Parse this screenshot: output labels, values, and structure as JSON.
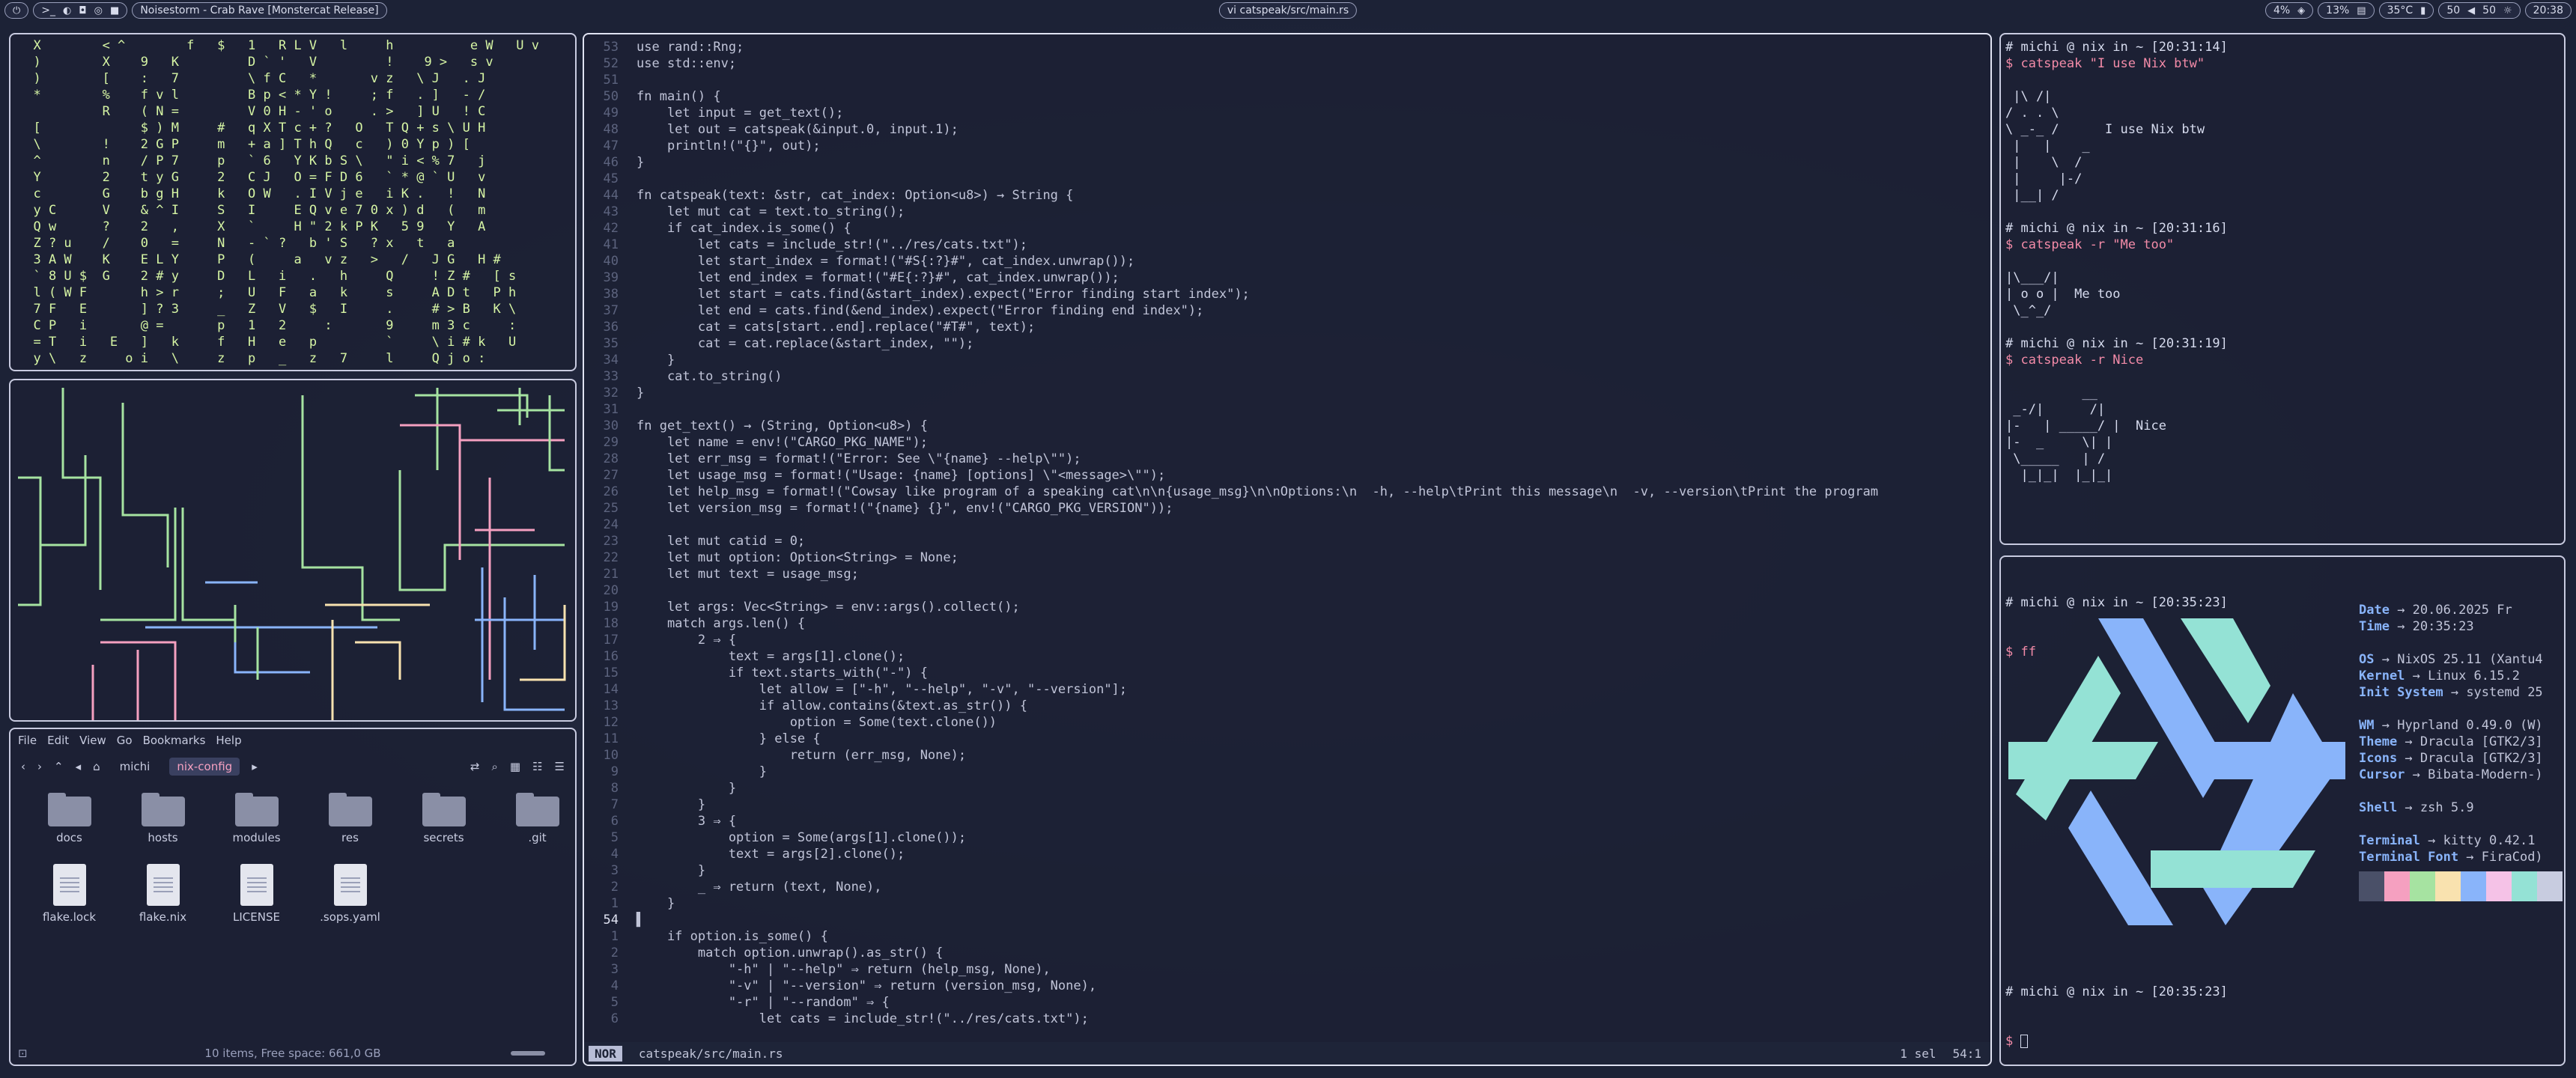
{
  "topbar": {
    "workspace_label": ">_",
    "media_title": "Noisestorm - Crab Rave [Monstercat Release]",
    "window_title": "vi catspeak/src/main.rs",
    "cpu": "4%",
    "mem": "13%",
    "temp": "35°C",
    "volume": "50",
    "brightness": "50",
    "clock": "20:38"
  },
  "matrix": {
    "lines": [
      "  X        < ^        f   $   1   R L V   l     h          e W   U v",
      "  )        X    9   K         D ` '   V         !    9 >   s v",
      "  )        [    :   7         \\ f C   *       v z   \\ J   . J",
      "  *        %    f v l         B p < * Y !     ; f   . ]   - /",
      "           R    ( N =         V 0 H - ' o     . >   ] U   ! C",
      "  [             $ ) M     #   q X T c + ?   O   T Q + s \\ U H",
      "  \\        !    2 G P     m   + a ] T h Q   c   ) 0 Y p ) [",
      "  ^        n    / P 7     p   ` 6   Y K b S \\   \" i < % 7   j",
      "  Y        2    t y G     2   C J   O = F D 6   ` * @ ` U   v",
      "  c        G    b g H     k   O W   . I V j e   i K .   !   N",
      "  y C      V    & ^ I     S   I     E Q v e 7 0 x ) d   (   m",
      "  Q w      ?    2   ,     X   `     H \" 2 k P K   5 9   Y   A",
      "  Z ? u    /    0   =     N   - ` ?   b ' S   ? x   t   a",
      "  3 A W    K    E L Y     P   (     a   v z   >   /   J G   H #",
      "  ` 8 U $  G    2 # y     D   L   i   .   h     Q     ! Z #   [ s",
      "  l ( W F       h > r     ;   U   F   a   k     s     A D t   P h",
      "  7 F   E       ] ? 3     _   Z   V   $   I     .     # > B   K \\",
      "  C P   i       @ =       p   1   2     :       9     m 3 c     :",
      "  = T   i   E   ]   k     f   H   e   p         `     \\ i # k   U",
      "  y \\   z     o i   \\     z   p   _   z   7     l     Q j o :"
    ]
  },
  "editor": {
    "mode": "NOR",
    "file_path": "catspeak/src/main.rs",
    "selection": "1 sel",
    "position": "54:1",
    "lines": [
      {
        "n": "53",
        "t": "use rand::Rng;"
      },
      {
        "n": "52",
        "t": "use std::env;"
      },
      {
        "n": "51",
        "t": ""
      },
      {
        "n": "50",
        "t": "fn main() {"
      },
      {
        "n": "49",
        "t": "    let input = get_text();"
      },
      {
        "n": "48",
        "t": "    let out = catspeak(&input.0, input.1);"
      },
      {
        "n": "47",
        "t": "    println!(\"{}\", out);"
      },
      {
        "n": "46",
        "t": "}"
      },
      {
        "n": "45",
        "t": ""
      },
      {
        "n": "44",
        "t": "fn catspeak(text: &str, cat_index: Option<u8>) → String {"
      },
      {
        "n": "43",
        "t": "    let mut cat = text.to_string();"
      },
      {
        "n": "42",
        "t": "    if cat_index.is_some() {"
      },
      {
        "n": "41",
        "t": "        let cats = include_str!(\"../res/cats.txt\");"
      },
      {
        "n": "40",
        "t": "        let start_index = format!(\"#S{:?}#\", cat_index.unwrap());"
      },
      {
        "n": "39",
        "t": "        let end_index = format!(\"#E{:?}#\", cat_index.unwrap());"
      },
      {
        "n": "38",
        "t": "        let start = cats.find(&start_index).expect(\"Error finding start index\");"
      },
      {
        "n": "37",
        "t": "        let end = cats.find(&end_index).expect(\"Error finding end index\");"
      },
      {
        "n": "36",
        "t": "        cat = cats[start..end].replace(\"#T#\", text);"
      },
      {
        "n": "35",
        "t": "        cat = cat.replace(&start_index, \"\");"
      },
      {
        "n": "34",
        "t": "    }"
      },
      {
        "n": "33",
        "t": "    cat.to_string()"
      },
      {
        "n": "32",
        "t": "}"
      },
      {
        "n": "31",
        "t": ""
      },
      {
        "n": "30",
        "t": "fn get_text() → (String, Option<u8>) {"
      },
      {
        "n": "29",
        "t": "    let name = env!(\"CARGO_PKG_NAME\");"
      },
      {
        "n": "28",
        "t": "    let err_msg = format!(\"Error: See \\\"{name} --help\\\"\");"
      },
      {
        "n": "27",
        "t": "    let usage_msg = format!(\"Usage: {name} [options] \\\"<message>\\\"\");"
      },
      {
        "n": "26",
        "t": "    let help_msg = format!(\"Cowsay like program of a speaking cat\\n\\n{usage_msg}\\n\\nOptions:\\n  -h, --help\\tPrint this message\\n  -v, --version\\tPrint the program"
      },
      {
        "n": "25",
        "t": "    let version_msg = format!(\"{name} {}\", env!(\"CARGO_PKG_VERSION\"));"
      },
      {
        "n": "24",
        "t": ""
      },
      {
        "n": "23",
        "t": "    let mut catid = 0;"
      },
      {
        "n": "22",
        "t": "    let mut option: Option<String> = None;"
      },
      {
        "n": "21",
        "t": "    let mut text = usage_msg;"
      },
      {
        "n": "20",
        "t": ""
      },
      {
        "n": "19",
        "t": "    let args: Vec<String> = env::args().collect();"
      },
      {
        "n": "18",
        "t": "    match args.len() {"
      },
      {
        "n": "17",
        "t": "        2 ⇒ {"
      },
      {
        "n": "16",
        "t": "            text = args[1].clone();"
      },
      {
        "n": "15",
        "t": "            if text.starts_with(\"-\") {"
      },
      {
        "n": "14",
        "t": "                let allow = [\"-h\", \"--help\", \"-v\", \"--version\"];"
      },
      {
        "n": "13",
        "t": "                if allow.contains(&text.as_str()) {"
      },
      {
        "n": "12",
        "t": "                    option = Some(text.clone())"
      },
      {
        "n": "11",
        "t": "                } else {"
      },
      {
        "n": "10",
        "t": "                    return (err_msg, None);"
      },
      {
        "n": "9",
        "t": "                }"
      },
      {
        "n": "8",
        "t": "            }"
      },
      {
        "n": "7",
        "t": "        }"
      },
      {
        "n": "6",
        "t": "        3 ⇒ {"
      },
      {
        "n": "5",
        "t": "            option = Some(args[1].clone());"
      },
      {
        "n": "4",
        "t": "            text = args[2].clone();"
      },
      {
        "n": "3",
        "t": "        }"
      },
      {
        "n": "2",
        "t": "        _ ⇒ return (text, None),"
      },
      {
        "n": "1",
        "t": "    }"
      },
      {
        "n": "54",
        "t": "▌"
      },
      {
        "n": "1",
        "t": "    if option.is_some() {"
      },
      {
        "n": "2",
        "t": "        match option.unwrap().as_str() {"
      },
      {
        "n": "3",
        "t": "            \"-h\" | \"--help\" ⇒ return (help_msg, None),"
      },
      {
        "n": "4",
        "t": "            \"-v\" | \"--version\" ⇒ return (version_msg, None),"
      },
      {
        "n": "5",
        "t": "            \"-r\" | \"--random\" ⇒ {"
      },
      {
        "n": "6",
        "t": "                let cats = include_str!(\"../res/cats.txt\");"
      }
    ]
  },
  "term1": {
    "blocks": [
      {
        "prompt": "# michi @ nix in ~ [20:31:14]",
        "cmd": "$ catspeak \"I use Nix btw\"",
        "out": "\n |\\ /|\n/ . . \\\n\\ _-_ /      I use Nix btw\n |   |    _\n |    \\  /\n |     |-/\n |__| /\n\n"
      },
      {
        "prompt": "# michi @ nix in ~ [20:31:16]",
        "cmd": "$ catspeak -r \"Me too\"",
        "out": "\n|\\___/|\n| o o |  Me too\n \\_^_/\n\n"
      },
      {
        "prompt": "# michi @ nix in ~ [20:31:19]",
        "cmd": "$ catspeak -r Nice",
        "out": "\n          __\n _-/|      /|\n|-   | _____/ |  Nice\n|-  _     \\| |\n \\_____   | /\n  |_|_|  |_|_|"
      }
    ]
  },
  "term2": {
    "prompt1": "# michi @ nix in ~ [20:35:23]",
    "cmd1": "$ ff",
    "prompt2": "# michi @ nix in ~ [20:35:23]",
    "cmd2": "$ ",
    "info": [
      {
        "k": "Date",
        "v": "20.06.2025 Fr"
      },
      {
        "k": "Time",
        "v": "20:35:23"
      },
      {
        "k": "",
        "v": ""
      },
      {
        "k": "OS",
        "v": "NixOS 25.11 (Xantu4"
      },
      {
        "k": "Kernel",
        "v": "Linux 6.15.2"
      },
      {
        "k": "Init System",
        "v": "systemd 25"
      },
      {
        "k": "",
        "v": ""
      },
      {
        "k": "WM",
        "v": "Hyprland 0.49.0 (W)"
      },
      {
        "k": "Theme",
        "v": "Dracula [GTK2/3]"
      },
      {
        "k": "Icons",
        "v": "Dracula [GTK2/3]"
      },
      {
        "k": "Cursor",
        "v": "Bibata-Modern-)"
      },
      {
        "k": "",
        "v": ""
      },
      {
        "k": "Shell",
        "v": "zsh 5.9"
      },
      {
        "k": "",
        "v": ""
      },
      {
        "k": "Terminal",
        "v": "kitty 0.42.1"
      },
      {
        "k": "Terminal Font",
        "v": "FiraCod)"
      }
    ],
    "palette": [
      "#4a5068",
      "#f5a0c0",
      "#a6e3a1",
      "#f9e2af",
      "#89b4fa",
      "#f5c2e7",
      "#94e2d5",
      "#c8cce0"
    ]
  },
  "filemanager": {
    "menu": [
      "File",
      "Edit",
      "View",
      "Go",
      "Bookmarks",
      "Help"
    ],
    "crumbs": [
      "michi",
      "nix-config"
    ],
    "folders": [
      "docs",
      "hosts",
      "modules",
      "res",
      "secrets",
      ".git"
    ],
    "files": [
      "flake.lock",
      "flake.nix",
      "LICENSE",
      ".sops.yaml"
    ],
    "status": "10 items, Free space: 661,0 GB"
  }
}
